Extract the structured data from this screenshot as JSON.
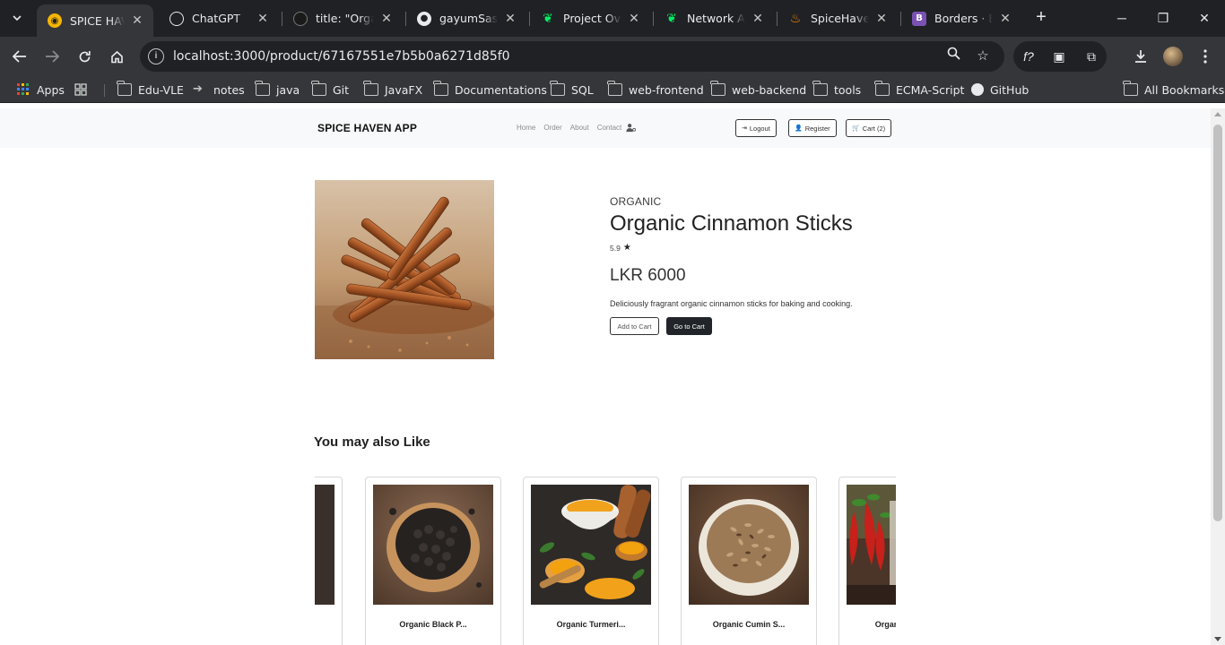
{
  "browser": {
    "tabs": [
      {
        "title": "SPICE HAVEN",
        "active": true
      },
      {
        "title": "ChatGPT"
      },
      {
        "title": "title: \"Organi"
      },
      {
        "title": "gayumSasiri/"
      },
      {
        "title": "Project Overv"
      },
      {
        "title": "Network Acc"
      },
      {
        "title": "SpiceHavenA"
      },
      {
        "title": "Borders · Boo"
      }
    ],
    "url": "localhost:3000/product/67167551e7b5b0a6271d85f0",
    "bookmarks": [
      "Apps",
      "Edu-VLE",
      "notes",
      "java",
      "Git",
      "JavaFX",
      "Documentations",
      "SQL",
      "web-frontend",
      "web-backend",
      "tools",
      "ECMA-Script",
      "GitHub"
    ],
    "all_bookmarks": "All Bookmarks"
  },
  "navbar": {
    "brand": "SPICE HAVEN APP",
    "links": [
      "Home",
      "Order",
      "About",
      "Contact"
    ],
    "logout": "Logout",
    "register": "Register",
    "cart": "Cart (2)"
  },
  "product": {
    "category": "ORGANIC",
    "title": "Organic Cinnamon Sticks",
    "rating": "5.9",
    "price": "LKR 6000",
    "description": "Deliciously fragrant organic cinnamon sticks for baking and cooking.",
    "add_to_cart": "Add to Cart",
    "go_to_cart": "Go to Cart"
  },
  "related": {
    "title": "You may also Like",
    "items": [
      {
        "name": ""
      },
      {
        "name": "Organic Black P..."
      },
      {
        "name": "Organic Turmeri..."
      },
      {
        "name": "Organic Cumin S..."
      },
      {
        "name": "Organ"
      }
    ]
  },
  "colors": {
    "chrome_dark": "#202124",
    "chrome_toolbar": "#35363a",
    "navbar_bg": "#f8f9fa",
    "button_dark": "#212529"
  }
}
